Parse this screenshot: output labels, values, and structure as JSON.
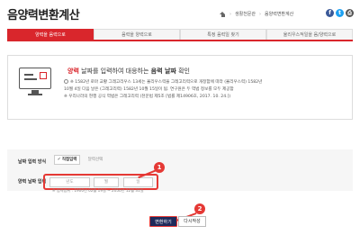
{
  "page_title": "음양력변환계산",
  "breadcrumb": {
    "home": "home-icon",
    "items": [
      "생활천문관",
      "음양력변환계산"
    ]
  },
  "social": {
    "facebook": "f",
    "twitter": "t",
    "print": "⎙"
  },
  "tabs": [
    "양력을 음력으로",
    "음력을 양력으로",
    "특정 음력일 찾기",
    "율리우스적일을 음/양력으로"
  ],
  "info": {
    "headline_pre": "양력",
    "headline_mid": " 날짜를 입력하여 대응하는 ",
    "headline_bold": "음력 날짜",
    "headline_post": " 확인",
    "notes": [
      "※ 1582년 로마 교황 그레고리우스 13세는 율리우스력을 그레고리력으로 개정함에 따라 (율리우스력) 1582년",
      "10월 4일 다음 날은 (그레고리력) 1582년 10월 15일이 됨. 연구원은 두 역법 정보를 모두 제공함",
      "※ 우리나라의 현행 공식 역법은 그레고리력 (천문법 제5조 [법률 제14906호, 2017. 10. 24.])"
    ]
  },
  "form": {
    "method_label": "날짜 입력 방식",
    "solar_label": "직접입력",
    "lunar_label": "달력선택",
    "date_label": "양력 날짜 입력",
    "year_placeholder": "년도",
    "month_placeholder": "월",
    "day_placeholder": "일",
    "hint": "※ 입력범위 : 1900년 02월 19일 ~ 2050년 12월 31일"
  },
  "buttons": {
    "convert": "변환하기",
    "reset": "다시작성"
  },
  "annotations": {
    "step1": "1",
    "step2": "2"
  },
  "colors": {
    "accent": "#d9262c",
    "navy": "#1e2a5a",
    "marker": "#e53935"
  }
}
